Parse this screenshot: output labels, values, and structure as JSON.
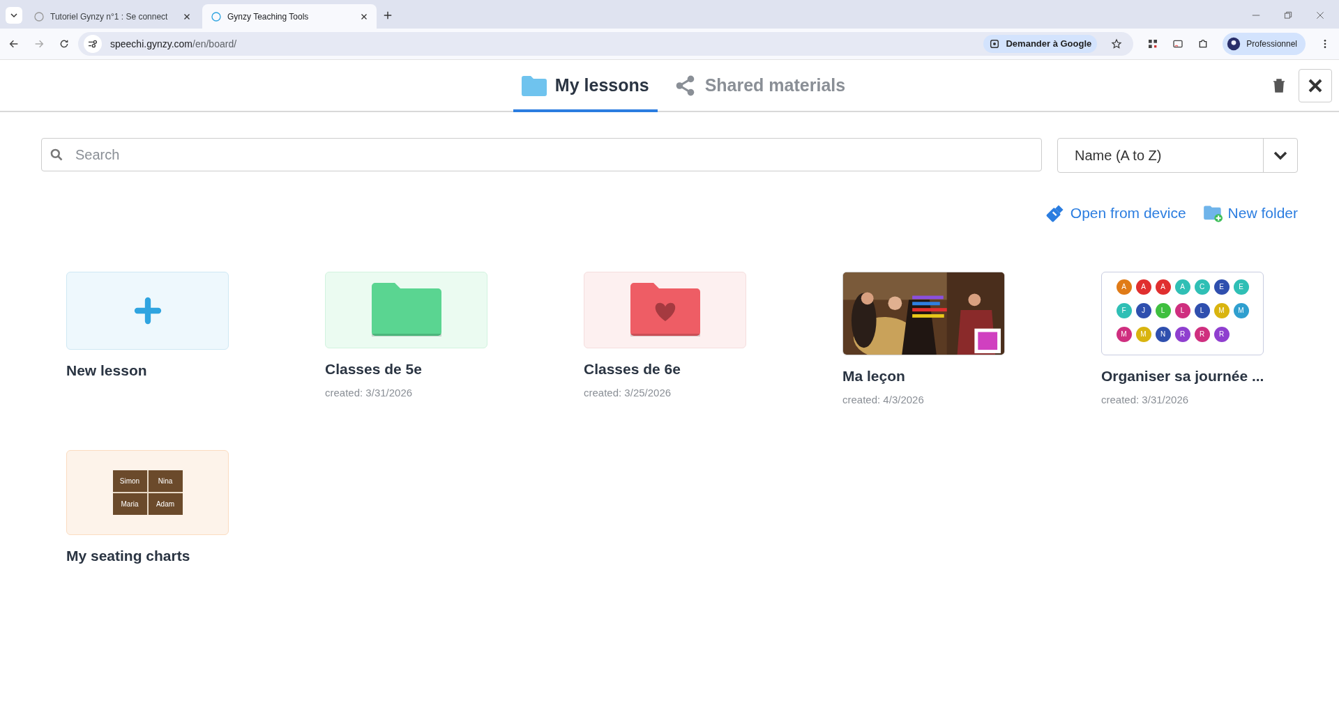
{
  "browser": {
    "tabs": [
      {
        "title": "Tutoriel Gynzy n°1 : Se connect",
        "selected": false
      },
      {
        "title": "Gynzy Teaching Tools",
        "selected": true
      }
    ],
    "url_host": "speechi.gynzy.com",
    "url_path": "/en/board/",
    "ask_google": "Demander à Google",
    "profile": "Professionnel"
  },
  "nav_tabs": [
    {
      "label": "My lessons",
      "kind": "folder",
      "selected": true
    },
    {
      "label": "Shared materials",
      "kind": "share",
      "selected": false
    }
  ],
  "search": {
    "placeholder": "Search"
  },
  "sort": {
    "value": "Name (A to Z)"
  },
  "actions": [
    {
      "label": "Open from device",
      "kind": "device"
    },
    {
      "label": "New folder",
      "kind": "folder"
    }
  ],
  "items": [
    {
      "kind": "new",
      "title": "New lesson"
    },
    {
      "kind": "folder",
      "title": "Classes de 5e",
      "created": "created: 3/31/2026",
      "color": "#5ad591"
    },
    {
      "kind": "heart-folder",
      "title": "Classes de 6e",
      "created": "created: 3/25/2026",
      "color": "#ee5d65"
    },
    {
      "kind": "painting",
      "title": "Ma leçon",
      "created": "created: 4/3/2026"
    },
    {
      "kind": "circles",
      "title": "Organiser sa journée ...",
      "created": "created: 3/31/2026",
      "circles": [
        {
          "letter": "A",
          "color": "#e07b17"
        },
        {
          "letter": "A",
          "color": "#e02f2f"
        },
        {
          "letter": "A",
          "color": "#e02f2f"
        },
        {
          "letter": "A",
          "color": "#2fbfb5"
        },
        {
          "letter": "C",
          "color": "#2fbfb5"
        },
        {
          "letter": "E",
          "color": "#2f4fae"
        },
        {
          "letter": "E",
          "color": "#2fbfb5"
        },
        {
          "letter": "F",
          "color": "#2fbfb5"
        },
        {
          "letter": "J",
          "color": "#2f4fae"
        },
        {
          "letter": "L",
          "color": "#3fbf3f"
        },
        {
          "letter": "L",
          "color": "#cf2f7f"
        },
        {
          "letter": "L",
          "color": "#2f4fae"
        },
        {
          "letter": "M",
          "color": "#d9b40f"
        },
        {
          "letter": "M",
          "color": "#2f9fcf"
        },
        {
          "letter": "M",
          "color": "#cf2f7f"
        },
        {
          "letter": "M",
          "color": "#d9b40f"
        },
        {
          "letter": "N",
          "color": "#2f4fae"
        },
        {
          "letter": "R",
          "color": "#8f3fcf"
        },
        {
          "letter": "R",
          "color": "#cf2f7f"
        },
        {
          "letter": "R",
          "color": "#8f3fcf"
        }
      ]
    },
    {
      "kind": "seating",
      "title": "My seating charts",
      "seats": [
        "Simon",
        "Nina",
        "Maria",
        "Adam"
      ]
    }
  ]
}
